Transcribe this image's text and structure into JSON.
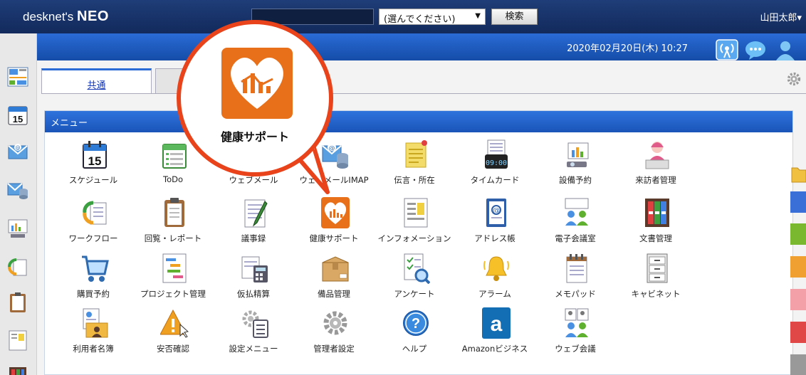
{
  "header": {
    "logo_text": "desknet's",
    "logo_bold": "NEO",
    "search_value": "",
    "scope_select": "(選んでください)",
    "search_button": "検索",
    "user_name": "山田太郎▾"
  },
  "subbar": {
    "datetime": "2020年02月20日(木) 10:27"
  },
  "tabs": [
    {
      "label": "共通"
    },
    {
      "label": ""
    }
  ],
  "panel": {
    "title": "メニュー"
  },
  "callout": {
    "label": "健康サポート"
  },
  "menu_items": [
    {
      "label": "スケジュール"
    },
    {
      "label": "ToDo"
    },
    {
      "label": "ウェブメール"
    },
    {
      "label": "ウェブメールIMAP"
    },
    {
      "label": "伝言・所在"
    },
    {
      "label": "タイムカード"
    },
    {
      "label": "設備予約"
    },
    {
      "label": "来訪者管理"
    },
    {
      "label": "ワークフロー"
    },
    {
      "label": "回覧・レポート"
    },
    {
      "label": "議事録"
    },
    {
      "label": "健康サポート"
    },
    {
      "label": "インフォメーション"
    },
    {
      "label": "アドレス帳"
    },
    {
      "label": "電子会議室"
    },
    {
      "label": "文書管理"
    },
    {
      "label": "購買予約"
    },
    {
      "label": "プロジェクト管理"
    },
    {
      "label": "仮払精算"
    },
    {
      "label": "備品管理"
    },
    {
      "label": "アンケート"
    },
    {
      "label": "アラーム"
    },
    {
      "label": "メモパッド"
    },
    {
      "label": "キャビネット"
    },
    {
      "label": "利用者名簿"
    },
    {
      "label": "安否確認"
    },
    {
      "label": "設定メニュー"
    },
    {
      "label": "管理者設定"
    },
    {
      "label": "ヘルプ"
    },
    {
      "label": "Amazonビジネス"
    },
    {
      "label": "ウェブ会議"
    }
  ],
  "icons": {
    "schedule_day": "15",
    "timecard_time": "09:00"
  },
  "colors": {
    "header_bg": "#1a3670",
    "subbar_bg": "#1f5fc8",
    "accent_orange": "#e8701a",
    "callout_border": "#e8431a"
  }
}
